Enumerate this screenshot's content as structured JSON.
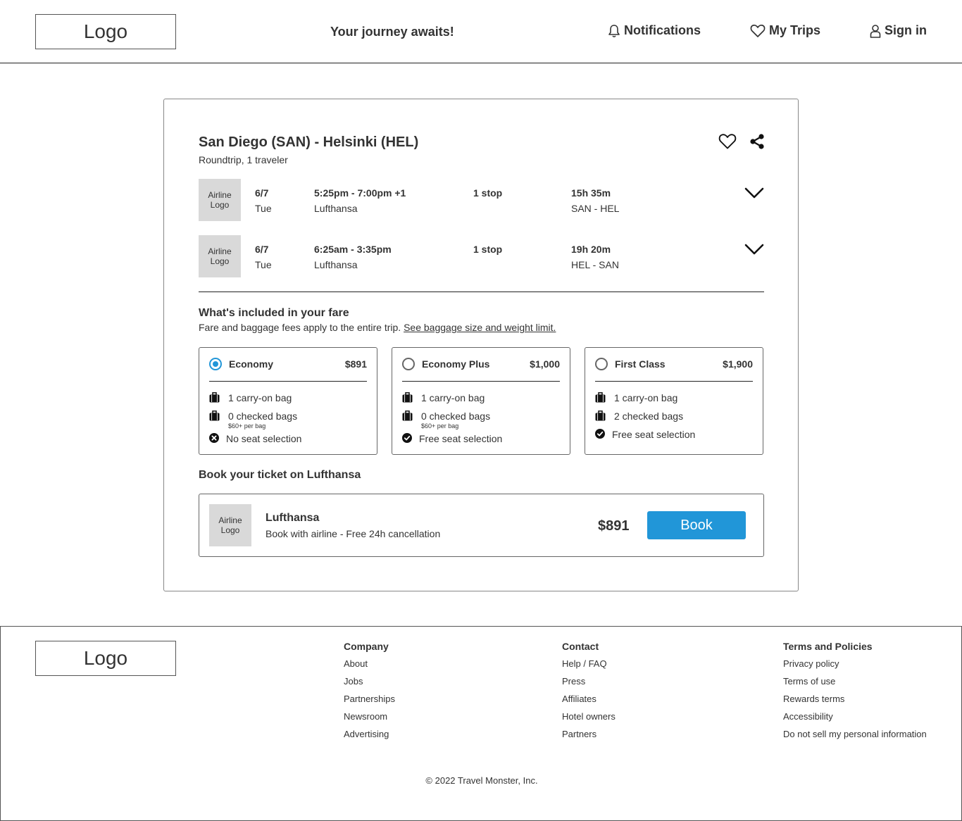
{
  "header": {
    "logo": "Logo",
    "tagline": "Your journey awaits!",
    "nav": {
      "notifications": "Notifications",
      "my_trips": "My Trips",
      "sign_in": "Sign in"
    }
  },
  "trip": {
    "title": "San Diego (SAN) - Helsinki (HEL)",
    "subtitle": "Roundtrip, 1 traveler",
    "flights": [
      {
        "logo": "Airline Logo",
        "date": "6/7",
        "day": "Tue",
        "time": "5:25pm - 7:00pm +1",
        "airline": "Lufthansa",
        "stops": "1 stop",
        "duration": "15h 35m",
        "route": "SAN - HEL"
      },
      {
        "logo": "Airline Logo",
        "date": "6/7",
        "day": "Tue",
        "time": "6:25am - 3:35pm",
        "airline": "Lufthansa",
        "stops": "1 stop",
        "duration": "19h 20m",
        "route": "HEL - SAN"
      }
    ]
  },
  "fare": {
    "heading": "What's included in your fare",
    "note": "Fare and baggage fees apply to the entire trip.",
    "link": "See baggage size and weight limit.",
    "options": [
      {
        "name": "Economy",
        "price": "$891",
        "selected": true,
        "carry_on": "1 carry-on bag",
        "checked": "0 checked bags",
        "checked_note": "$60+ per bag",
        "seat": "No seat selection",
        "seat_icon": "x-circle-icon"
      },
      {
        "name": "Economy Plus",
        "price": "$1,000",
        "selected": false,
        "carry_on": "1 carry-on bag",
        "checked": "0 checked bags",
        "checked_note": "$60+ per bag",
        "seat": "Free seat selection",
        "seat_icon": "check-circle-icon"
      },
      {
        "name": "First Class",
        "price": "$1,900",
        "selected": false,
        "carry_on": "1 carry-on bag",
        "checked": "2 checked bags",
        "checked_note": "",
        "seat": "Free seat selection",
        "seat_icon": "check-circle-icon"
      }
    ]
  },
  "booking": {
    "heading": "Book your ticket on Lufthansa",
    "logo": "Airline Logo",
    "airline": "Lufthansa",
    "description": "Book with airline - Free 24h cancellation",
    "price": "$891",
    "button": "Book",
    "accent_color": "#2196d8"
  },
  "footer": {
    "logo": "Logo",
    "columns": [
      {
        "title": "Company",
        "links": [
          "About",
          "Jobs",
          "Partnerships",
          "Newsroom",
          "Advertising"
        ]
      },
      {
        "title": "Contact",
        "links": [
          "Help / FAQ",
          "Press",
          "Affiliates",
          "Hotel owners",
          "Partners"
        ]
      },
      {
        "title": "Terms and Policies",
        "links": [
          "Privacy policy",
          "Terms of use",
          "Rewards terms",
          "Accessibility",
          "Do not sell my personal information"
        ]
      }
    ],
    "copyright": "© 2022 Travel Monster, Inc."
  }
}
